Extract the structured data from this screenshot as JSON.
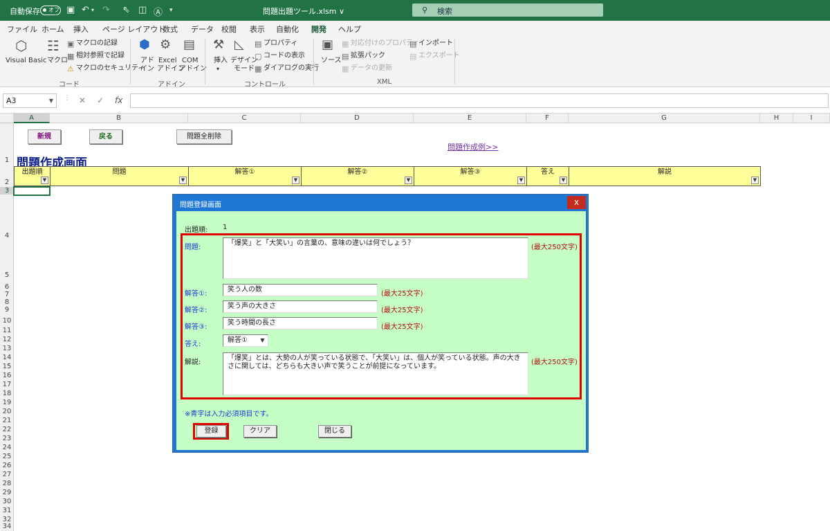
{
  "titlebar": {
    "autosave_label": "自動保存",
    "toggle_state": "オフ",
    "file_title": "問題出題ツール.xlsm ∨",
    "search_placeholder": "検索"
  },
  "ribbon_tabs": [
    "ファイル",
    "ホーム",
    "挿入",
    "ページ レイアウト",
    "数式",
    "データ",
    "校閲",
    "表示",
    "自動化",
    "開発",
    "ヘルプ"
  ],
  "ribbon": {
    "code": {
      "visual_basic": "Visual Basic",
      "macro": "マクロ",
      "record_macro": "マクロの記録",
      "relative_ref": "相対参照で記録",
      "macro_security": "マクロのセキュリティ",
      "group": "コード"
    },
    "addins": {
      "addin_line1": "アド",
      "addin_line2": "イン",
      "excel_line1": "Excel",
      "excel_line2": "アドイン",
      "com_line1": "COM",
      "com_line2": "アドイン",
      "group": "アドイン"
    },
    "controls": {
      "insert": "挿入",
      "design_line1": "デザイン",
      "design_line2": "モード",
      "properties": "プロパティ",
      "view_code": "コードの表示",
      "run_dialog": "ダイアログの実行",
      "group": "コントロール"
    },
    "xml": {
      "source": "ソース",
      "map_properties": "対応付けのプロパティ",
      "expansion_packs": "拡張パック",
      "refresh_data": "データの更新",
      "import": "インポート",
      "export": "エクスポート",
      "group": "XML"
    }
  },
  "formula_bar": {
    "name_box": "A3",
    "fx": "fx"
  },
  "columns": [
    "A",
    "B",
    "C",
    "D",
    "E",
    "F",
    "G",
    "H",
    "I"
  ],
  "rows": [
    "1",
    "2",
    "3",
    "4",
    "5",
    "6",
    "7",
    "8",
    "9",
    "10",
    "11",
    "12",
    "13",
    "14",
    "15",
    "16",
    "17",
    "18",
    "19",
    "20",
    "21",
    "22",
    "23",
    "24",
    "25",
    "26",
    "27",
    "28",
    "29",
    "30",
    "31",
    "32",
    "33",
    "34"
  ],
  "sheet": {
    "buttons": {
      "new": "新規",
      "back": "戻る",
      "delete_all": "問題全削除"
    },
    "heading": "問題作成画面",
    "example_link": "問題作成例>>",
    "table_headers": [
      "出題順",
      "問題",
      "解答①",
      "解答②",
      "解答③",
      "答え",
      "解説"
    ]
  },
  "dialog": {
    "title": "問題登録画面",
    "close": "x",
    "order_label": "出題順:",
    "order_value": "1",
    "question_label": "問題:",
    "question_value": "「爆笑」と「大笑い」の言葉の、意味の違いは何でしょう？",
    "question_limit": "(最大250文字)",
    "answer1_label": "解答①:",
    "answer1_value": "笑う人の数",
    "answer1_limit": "(最大25文字)",
    "answer2_label": "解答②:",
    "answer2_value": "笑う声の大きさ",
    "answer2_limit": "(最大25文字)",
    "answer3_label": "解答③:",
    "answer3_value": "笑う時間の長さ",
    "answer3_limit": "(最大25文字)",
    "correct_label": "答え:",
    "correct_value": "解答①",
    "explanation_label": "解説:",
    "explanation_value": "「爆笑」とは、大勢の人が笑っている状態で、「大笑い」は、個人が笑っている状態。声の大きさに関しては、どちらも大きい声で笑うことが前提になっています。",
    "explanation_limit": "(最大250文字)",
    "required_note": "※青字は入力必須項目です。",
    "btn_register": "登録",
    "btn_clear": "クリア",
    "btn_close": "閉じる"
  }
}
